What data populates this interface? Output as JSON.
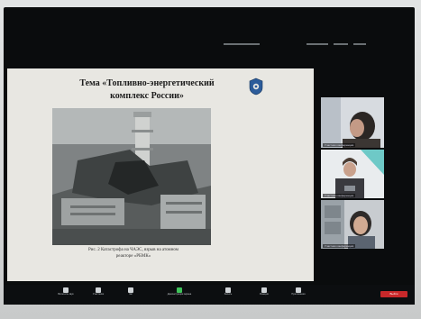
{
  "slide": {
    "title_line1": "Тема «Топливно-энергетический",
    "title_line2": "комплекс России»",
    "caption_line1": "Рис. 2 Катастрофа на ЧАЭС, взрыв на атомном",
    "caption_line2": "реакторе «РБМК»"
  },
  "participants": [
    {
      "name": "Участник конференции"
    },
    {
      "name": "Участник конференции"
    },
    {
      "name": "Участник конференции"
    }
  ],
  "toolbar": {
    "items": [
      {
        "label": "Включить звук",
        "icon": "microphone-icon"
      },
      {
        "label": "Участники",
        "icon": "participants-icon"
      },
      {
        "label": "Чат",
        "icon": "chat-icon"
      },
      {
        "label": "Демонстрация экрана",
        "icon": "share-screen-icon"
      },
      {
        "label": "Запись",
        "icon": "record-icon"
      },
      {
        "label": "Реакции",
        "icon": "reactions-icon"
      },
      {
        "label": "Приложения",
        "icon": "apps-icon"
      }
    ],
    "leave_label": "Выйти"
  },
  "colors": {
    "leave": "#c8282a",
    "screen_bg": "#0a0c0d",
    "slide_bg": "#e8e7e2"
  }
}
